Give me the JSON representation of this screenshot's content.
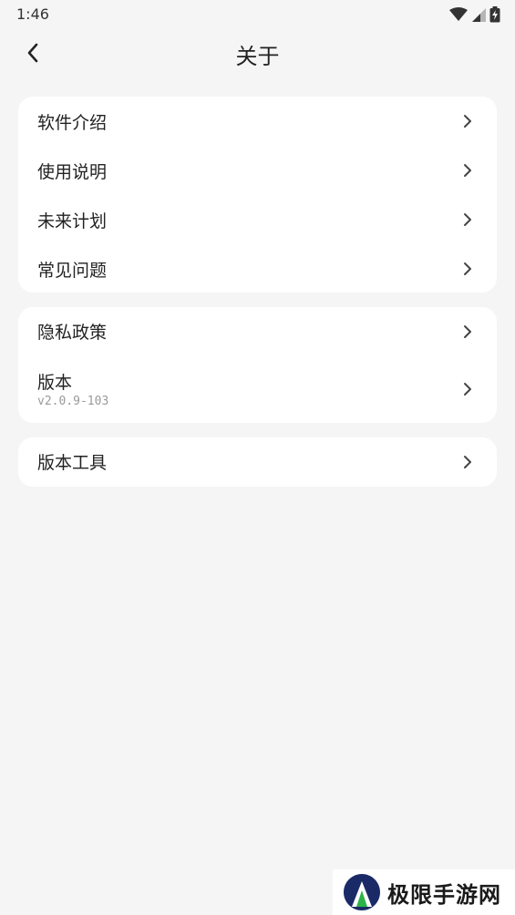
{
  "status_bar": {
    "time": "1:46",
    "icons": [
      "wifi-icon",
      "cellular-signal-icon",
      "battery-charging-icon"
    ]
  },
  "app_bar": {
    "title": "关于",
    "back_icon": "chevron-left-icon"
  },
  "groups": [
    {
      "items": [
        {
          "label": "软件介绍"
        },
        {
          "label": "使用说明"
        },
        {
          "label": "未来计划"
        },
        {
          "label": "常见问题"
        }
      ]
    },
    {
      "items": [
        {
          "label": "隐私政策"
        },
        {
          "label": "版本",
          "sub": "v2.0.9-103"
        }
      ]
    },
    {
      "items": [
        {
          "label": "版本工具"
        }
      ]
    }
  ],
  "watermark": {
    "text": "极限手游网"
  },
  "colors": {
    "background": "#f5f5f5",
    "card": "#ffffff",
    "text": "#222222",
    "secondary_text": "#9a9a9a",
    "chevron": "#444444"
  }
}
